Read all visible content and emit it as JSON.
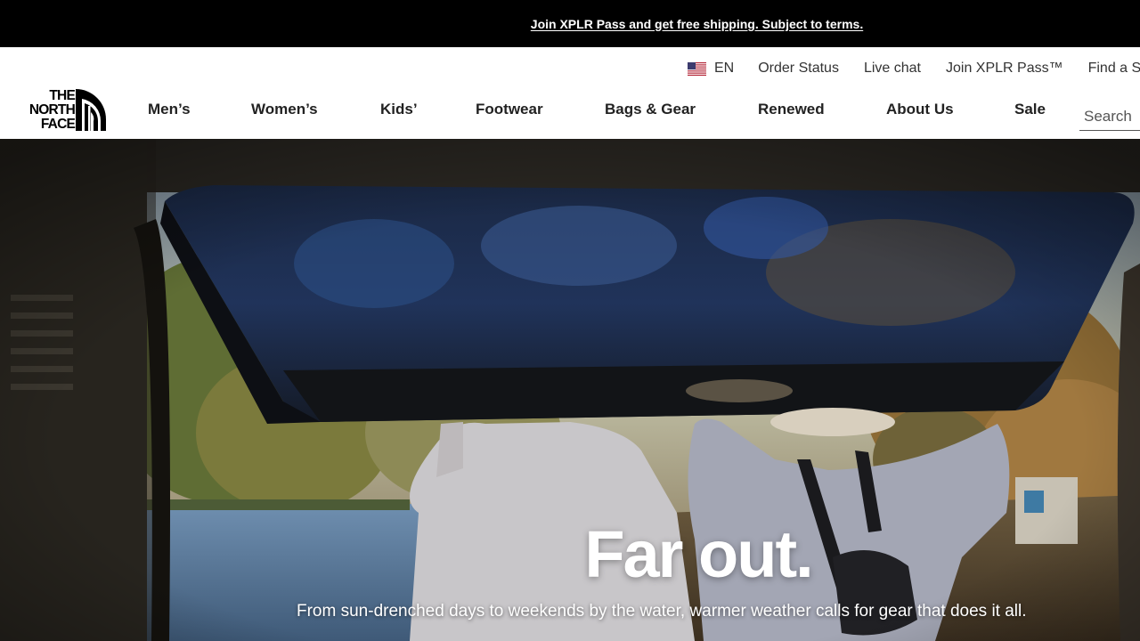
{
  "promo_banner": {
    "text": "Join XPLR Pass and get free shipping. Subject to terms."
  },
  "utility_nav": {
    "language": {
      "code": "EN",
      "icon": "us-flag-icon"
    },
    "items": [
      {
        "label": "Order Status"
      },
      {
        "label": "Live chat"
      },
      {
        "label": "Join XPLR Pass™"
      },
      {
        "label": "Find a S"
      }
    ]
  },
  "logo": {
    "lines": [
      "THE",
      "NORTH",
      "FACE"
    ],
    "icon": "north-face-half-dome-icon"
  },
  "main_nav": {
    "items": [
      {
        "label": "Men’s"
      },
      {
        "label": "Women’s"
      },
      {
        "label": "Kids’"
      },
      {
        "label": "Footwear"
      },
      {
        "label": "Bags & Gear"
      },
      {
        "label": "Renewed"
      },
      {
        "label": "About Us"
      },
      {
        "label": "Sale"
      }
    ]
  },
  "search": {
    "placeholder": "Search"
  },
  "hero": {
    "title": "Far out.",
    "subtitle": "From sun-drenched days to weekends by the water, warmer weather calls for gear that does it all."
  },
  "colors": {
    "banner_bg": "#000000",
    "header_bg": "#ffffff",
    "nav_text": "#222222",
    "hero_text": "#ffffff"
  }
}
